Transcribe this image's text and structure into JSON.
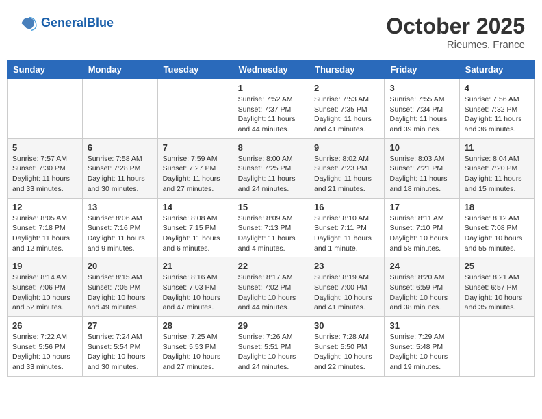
{
  "header": {
    "logo_general": "General",
    "logo_blue": "Blue",
    "month": "October 2025",
    "location": "Rieumes, France"
  },
  "weekdays": [
    "Sunday",
    "Monday",
    "Tuesday",
    "Wednesday",
    "Thursday",
    "Friday",
    "Saturday"
  ],
  "weeks": [
    [
      {
        "day": "",
        "info": ""
      },
      {
        "day": "",
        "info": ""
      },
      {
        "day": "",
        "info": ""
      },
      {
        "day": "1",
        "info": "Sunrise: 7:52 AM\nSunset: 7:37 PM\nDaylight: 11 hours\nand 44 minutes."
      },
      {
        "day": "2",
        "info": "Sunrise: 7:53 AM\nSunset: 7:35 PM\nDaylight: 11 hours\nand 41 minutes."
      },
      {
        "day": "3",
        "info": "Sunrise: 7:55 AM\nSunset: 7:34 PM\nDaylight: 11 hours\nand 39 minutes."
      },
      {
        "day": "4",
        "info": "Sunrise: 7:56 AM\nSunset: 7:32 PM\nDaylight: 11 hours\nand 36 minutes."
      }
    ],
    [
      {
        "day": "5",
        "info": "Sunrise: 7:57 AM\nSunset: 7:30 PM\nDaylight: 11 hours\nand 33 minutes."
      },
      {
        "day": "6",
        "info": "Sunrise: 7:58 AM\nSunset: 7:28 PM\nDaylight: 11 hours\nand 30 minutes."
      },
      {
        "day": "7",
        "info": "Sunrise: 7:59 AM\nSunset: 7:27 PM\nDaylight: 11 hours\nand 27 minutes."
      },
      {
        "day": "8",
        "info": "Sunrise: 8:00 AM\nSunset: 7:25 PM\nDaylight: 11 hours\nand 24 minutes."
      },
      {
        "day": "9",
        "info": "Sunrise: 8:02 AM\nSunset: 7:23 PM\nDaylight: 11 hours\nand 21 minutes."
      },
      {
        "day": "10",
        "info": "Sunrise: 8:03 AM\nSunset: 7:21 PM\nDaylight: 11 hours\nand 18 minutes."
      },
      {
        "day": "11",
        "info": "Sunrise: 8:04 AM\nSunset: 7:20 PM\nDaylight: 11 hours\nand 15 minutes."
      }
    ],
    [
      {
        "day": "12",
        "info": "Sunrise: 8:05 AM\nSunset: 7:18 PM\nDaylight: 11 hours\nand 12 minutes."
      },
      {
        "day": "13",
        "info": "Sunrise: 8:06 AM\nSunset: 7:16 PM\nDaylight: 11 hours\nand 9 minutes."
      },
      {
        "day": "14",
        "info": "Sunrise: 8:08 AM\nSunset: 7:15 PM\nDaylight: 11 hours\nand 6 minutes."
      },
      {
        "day": "15",
        "info": "Sunrise: 8:09 AM\nSunset: 7:13 PM\nDaylight: 11 hours\nand 4 minutes."
      },
      {
        "day": "16",
        "info": "Sunrise: 8:10 AM\nSunset: 7:11 PM\nDaylight: 11 hours\nand 1 minute."
      },
      {
        "day": "17",
        "info": "Sunrise: 8:11 AM\nSunset: 7:10 PM\nDaylight: 10 hours\nand 58 minutes."
      },
      {
        "day": "18",
        "info": "Sunrise: 8:12 AM\nSunset: 7:08 PM\nDaylight: 10 hours\nand 55 minutes."
      }
    ],
    [
      {
        "day": "19",
        "info": "Sunrise: 8:14 AM\nSunset: 7:06 PM\nDaylight: 10 hours\nand 52 minutes."
      },
      {
        "day": "20",
        "info": "Sunrise: 8:15 AM\nSunset: 7:05 PM\nDaylight: 10 hours\nand 49 minutes."
      },
      {
        "day": "21",
        "info": "Sunrise: 8:16 AM\nSunset: 7:03 PM\nDaylight: 10 hours\nand 47 minutes."
      },
      {
        "day": "22",
        "info": "Sunrise: 8:17 AM\nSunset: 7:02 PM\nDaylight: 10 hours\nand 44 minutes."
      },
      {
        "day": "23",
        "info": "Sunrise: 8:19 AM\nSunset: 7:00 PM\nDaylight: 10 hours\nand 41 minutes."
      },
      {
        "day": "24",
        "info": "Sunrise: 8:20 AM\nSunset: 6:59 PM\nDaylight: 10 hours\nand 38 minutes."
      },
      {
        "day": "25",
        "info": "Sunrise: 8:21 AM\nSunset: 6:57 PM\nDaylight: 10 hours\nand 35 minutes."
      }
    ],
    [
      {
        "day": "26",
        "info": "Sunrise: 7:22 AM\nSunset: 5:56 PM\nDaylight: 10 hours\nand 33 minutes."
      },
      {
        "day": "27",
        "info": "Sunrise: 7:24 AM\nSunset: 5:54 PM\nDaylight: 10 hours\nand 30 minutes."
      },
      {
        "day": "28",
        "info": "Sunrise: 7:25 AM\nSunset: 5:53 PM\nDaylight: 10 hours\nand 27 minutes."
      },
      {
        "day": "29",
        "info": "Sunrise: 7:26 AM\nSunset: 5:51 PM\nDaylight: 10 hours\nand 24 minutes."
      },
      {
        "day": "30",
        "info": "Sunrise: 7:28 AM\nSunset: 5:50 PM\nDaylight: 10 hours\nand 22 minutes."
      },
      {
        "day": "31",
        "info": "Sunrise: 7:29 AM\nSunset: 5:48 PM\nDaylight: 10 hours\nand 19 minutes."
      },
      {
        "day": "",
        "info": ""
      }
    ]
  ]
}
